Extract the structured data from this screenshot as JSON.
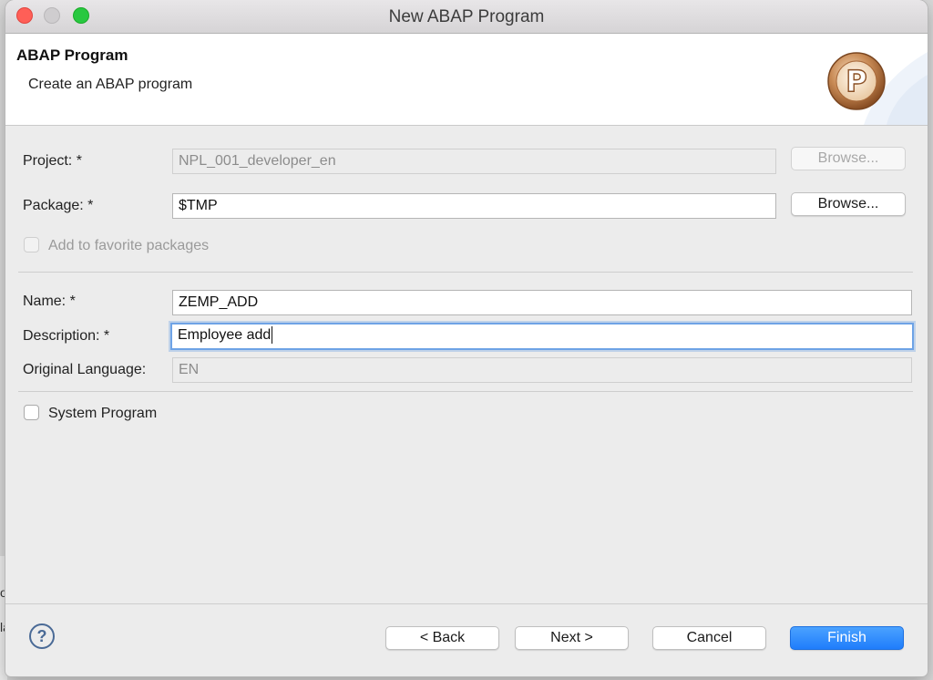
{
  "window": {
    "title": "New ABAP Program"
  },
  "banner": {
    "title": "ABAP Program",
    "subtitle": "Create an ABAP program",
    "icon": "program-p-icon",
    "icon_letter": "P"
  },
  "form": {
    "project": {
      "label": "Project: *",
      "value": "NPL_001_developer_en",
      "browse_label": "Browse...",
      "enabled": false
    },
    "package": {
      "label": "Package: *",
      "value": "$TMP",
      "browse_label": "Browse..."
    },
    "favorite": {
      "label": "Add to favorite packages",
      "checked": false,
      "enabled": false
    },
    "name": {
      "label": "Name: *",
      "value": "ZEMP_ADD"
    },
    "description": {
      "label": "Description: *",
      "value": "Employee add"
    },
    "original_language": {
      "label": "Original Language:",
      "value": "EN"
    },
    "system_program": {
      "label": "System Program",
      "checked": false
    }
  },
  "footer": {
    "help_icon": "question-mark-icon",
    "help_glyph": "?",
    "back_label": "< Back",
    "next_label": "Next >",
    "cancel_label": "Cancel",
    "finish_label": "Finish"
  },
  "background_fragments": [
    "o",
    "la"
  ],
  "colors": {
    "accent": "#1f7dfb",
    "focus_ring": "#6ea3e6",
    "icon_bronze": "#b5703a"
  }
}
